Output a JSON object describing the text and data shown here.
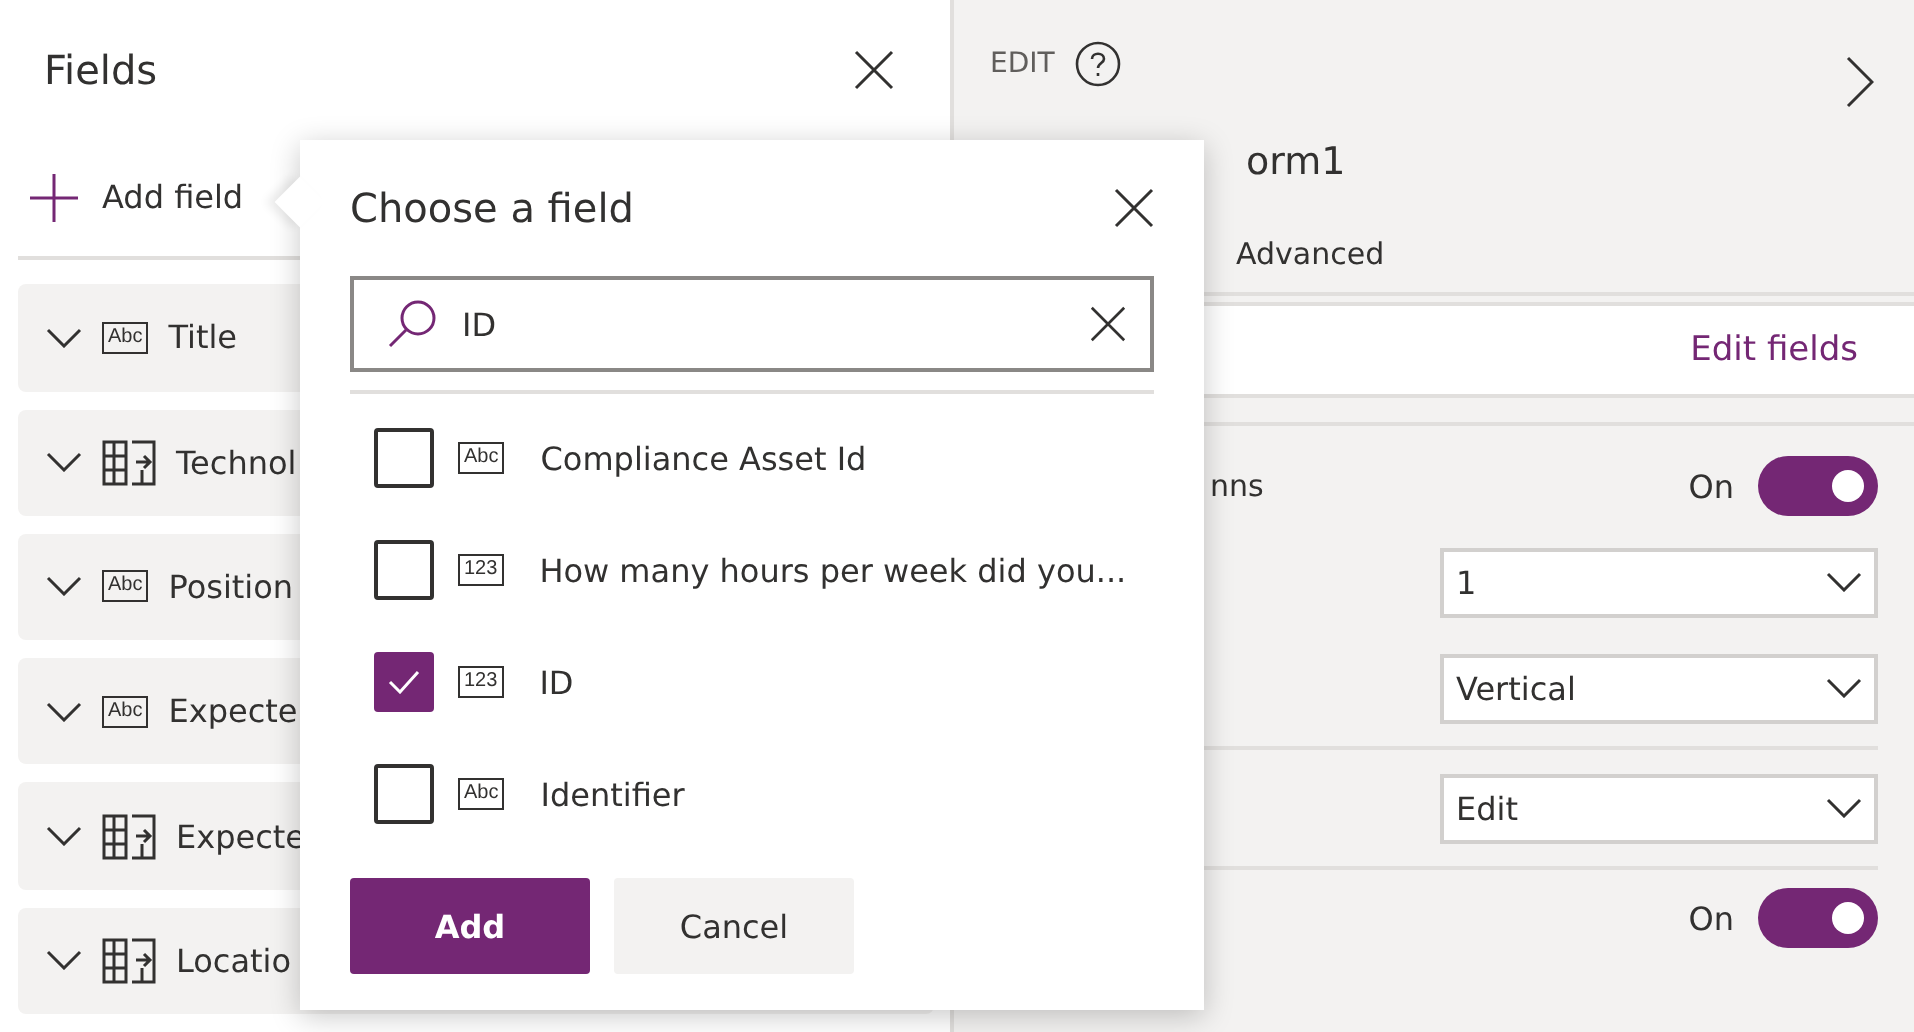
{
  "fields_panel": {
    "title": "Fields",
    "add_label": "Add field",
    "fields": [
      {
        "label": "Title",
        "kind": "text",
        "icon_text": "Abc"
      },
      {
        "label": "Technol",
        "kind": "lookup"
      },
      {
        "label": "Position",
        "kind": "text",
        "icon_text": "Abc"
      },
      {
        "label": "Expecte",
        "kind": "text",
        "icon_text": "Abc"
      },
      {
        "label": "Expecte",
        "kind": "lookup"
      },
      {
        "label": "Locatio",
        "kind": "lookup"
      }
    ]
  },
  "properties_panel": {
    "mode": "EDIT",
    "title": "orm1",
    "tabs": [
      {
        "label": "Advanced",
        "selected": false
      }
    ],
    "edit_fields_link": "Edit fields",
    "rows": [
      {
        "kind": "toggle",
        "label": "nns",
        "state_text": "On",
        "on": true
      },
      {
        "kind": "dropdown",
        "value": "1"
      },
      {
        "kind": "dropdown",
        "value": "Vertical",
        "divider_after": true
      },
      {
        "kind": "dropdown",
        "value": "Edit",
        "divider_after": true
      },
      {
        "kind": "toggle",
        "state_text": "On",
        "on": true
      }
    ]
  },
  "choose_field_dialog": {
    "title": "Choose a field",
    "search": {
      "value": "ID"
    },
    "options": [
      {
        "label": "Compliance Asset Id",
        "icon_text": "Abc",
        "checked": false
      },
      {
        "label": "How many hours per week did you...",
        "icon_text": "123",
        "checked": false
      },
      {
        "label": "ID",
        "icon_text": "123",
        "checked": true
      },
      {
        "label": "Identifier",
        "icon_text": "Abc",
        "checked": false
      }
    ],
    "buttons": [
      {
        "label": "Add",
        "kind": "primary"
      },
      {
        "label": "Cancel",
        "kind": "secondary"
      }
    ]
  }
}
